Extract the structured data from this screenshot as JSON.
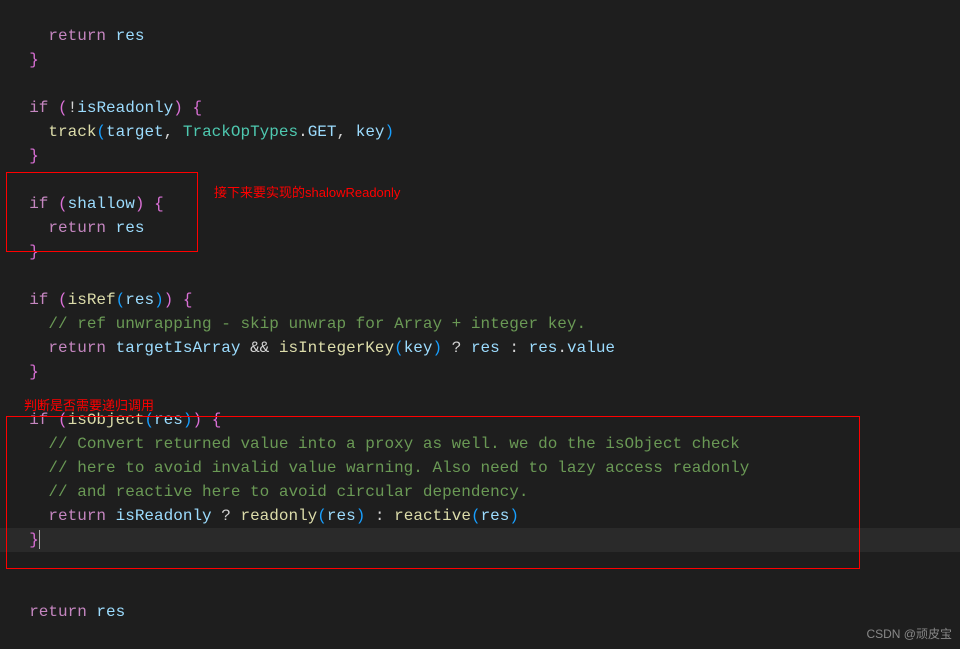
{
  "annotations": {
    "a1": "接下来要实现的shalowReadonly",
    "a2": "判断是否需要递归调用"
  },
  "watermark": "CSDN @顽皮宝",
  "code": {
    "l1_return": "return",
    "l1_res": "res",
    "l3_if": "if",
    "l3_not": "!",
    "l3_isReadonly": "isReadonly",
    "l4_track": "track",
    "l4_target": "target",
    "l4_TrackOpTypes": "TrackOpTypes",
    "l4_GET": "GET",
    "l4_key": "key",
    "l7_if": "if",
    "l7_shallow": "shallow",
    "l8_return": "return",
    "l8_res": "res",
    "l11_if": "if",
    "l11_isRef": "isRef",
    "l11_res": "res",
    "l12_comment": "// ref unwrapping - skip unwrap for Array + integer key.",
    "l13_return": "return",
    "l13_targetIsArray": "targetIsArray",
    "l13_isIntegerKey": "isIntegerKey",
    "l13_key": "key",
    "l13_res1": "res",
    "l13_res2": "res",
    "l13_value": "value",
    "l16_if": "if",
    "l16_isObject": "isObject",
    "l16_res": "res",
    "l17_comment": "// Convert returned value into a proxy as well. we do the isObject check",
    "l18_comment": "// here to avoid invalid value warning. Also need to lazy access readonly",
    "l19_comment": "// and reactive here to avoid circular dependency.",
    "l20_return": "return",
    "l20_isReadonly": "isReadonly",
    "l20_readonly": "readonly",
    "l20_res1": "res",
    "l20_reactive": "reactive",
    "l20_res2": "res",
    "l23_return": "return",
    "l23_res": "res"
  }
}
